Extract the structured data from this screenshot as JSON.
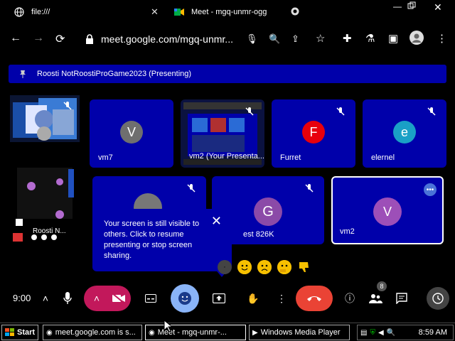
{
  "browser": {
    "tabs": [
      {
        "label": "file:///",
        "icon": "globe-icon"
      },
      {
        "label": "Meet - mgq-unmr-ogg",
        "icon": "meet-icon"
      }
    ],
    "url": "meet.google.com/mgq-unmr..."
  },
  "banner": {
    "text": "Roosti NotRoostiProGame2023 (Presenting)"
  },
  "side": {
    "label": "Roosti N..."
  },
  "participants": [
    {
      "name": "vm7",
      "initial": "V",
      "color": "#6f6f6f"
    },
    {
      "name": "vm2 (Your Presenta...",
      "initial": "",
      "color": "#000000"
    },
    {
      "name": "Furret",
      "initial": "F",
      "color": "#e8000c"
    },
    {
      "name": "elernel",
      "initial": "e",
      "color": "#1aa0c6"
    },
    {
      "name": "",
      "initial": "",
      "color": "#777777"
    },
    {
      "name": "est 826K",
      "initial": "G",
      "color": "#8b4aa8"
    },
    {
      "name": "vm2",
      "initial": "V",
      "color": "#9d4fb8"
    }
  ],
  "tooltip": {
    "text": "Your screen is still visible to others. Click to resume presenting or stop screen sharing."
  },
  "controls": {
    "time": "9:00",
    "participants_count": "8"
  },
  "taskbar": {
    "start": "Start",
    "items": [
      "meet.google.com is s...",
      "Meet - mgq-unmr-...",
      "Windows Media Player"
    ],
    "clock": "8:59 AM"
  },
  "colors": {
    "tile": "#0000aa",
    "end_call": "#ea4335",
    "camera_off": "#c2185b"
  }
}
